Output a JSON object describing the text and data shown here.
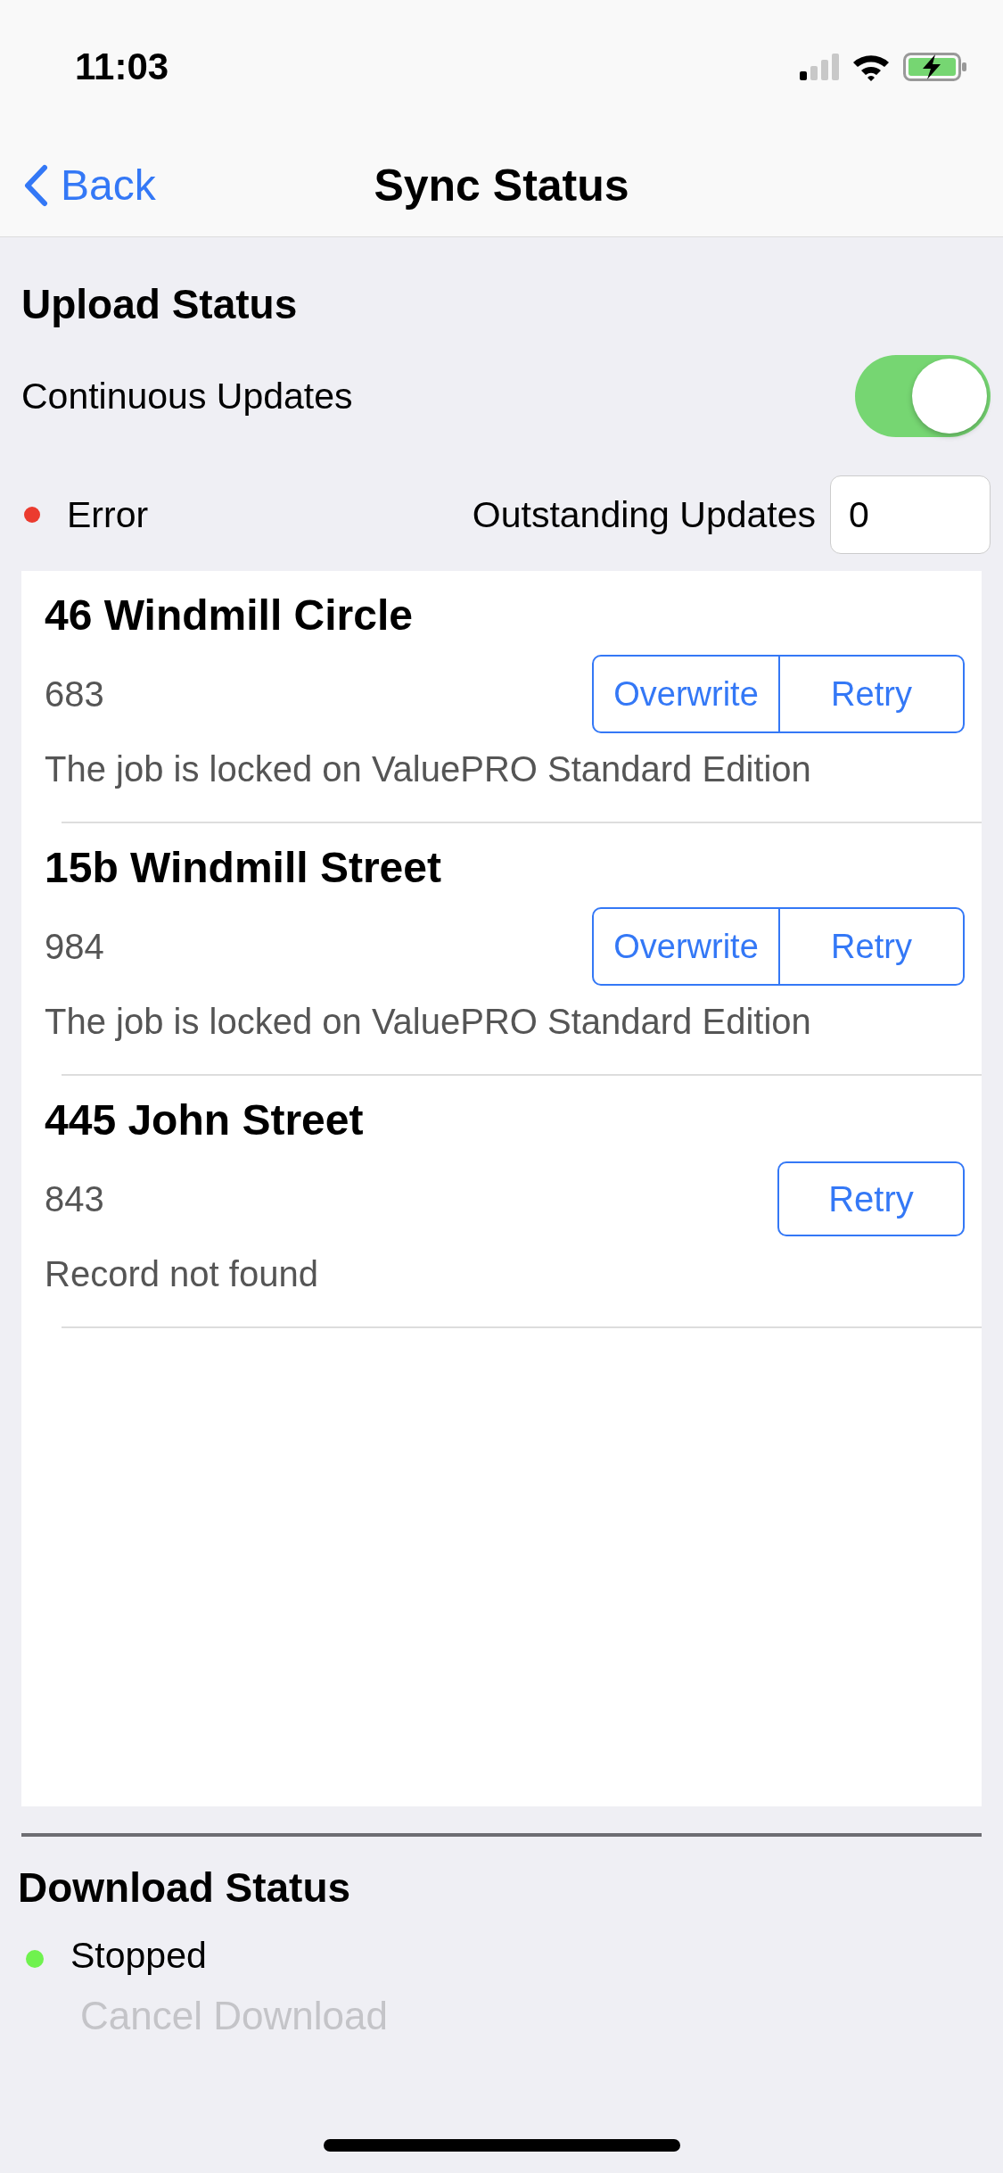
{
  "status_bar": {
    "time": "11:03"
  },
  "nav": {
    "back": "Back",
    "title": "Sync Status"
  },
  "upload": {
    "heading": "Upload Status",
    "continuous_updates": {
      "label": "Continuous Updates",
      "on": true
    },
    "status": {
      "label": "Error",
      "color": "#eb3b2f"
    },
    "outstanding": {
      "label": "Outstanding Updates",
      "value": "0"
    },
    "jobs": [
      {
        "title": "46 Windmill Circle",
        "number": "683",
        "message": "The job is locked on ValuePRO Standard Edition",
        "buttons": [
          "Overwrite",
          "Retry"
        ]
      },
      {
        "title": "15b Windmill Street",
        "number": "984",
        "message": "The job is locked on ValuePRO Standard Edition",
        "buttons": [
          "Overwrite",
          "Retry"
        ]
      },
      {
        "title": "445 John Street",
        "number": "843",
        "message": "Record not found",
        "buttons": [
          "Retry"
        ]
      }
    ]
  },
  "download": {
    "heading": "Download Status",
    "status": {
      "label": "Stopped",
      "color": "#6ff24e"
    },
    "cancel_button": {
      "label": "Cancel Download",
      "disabled": true
    }
  }
}
